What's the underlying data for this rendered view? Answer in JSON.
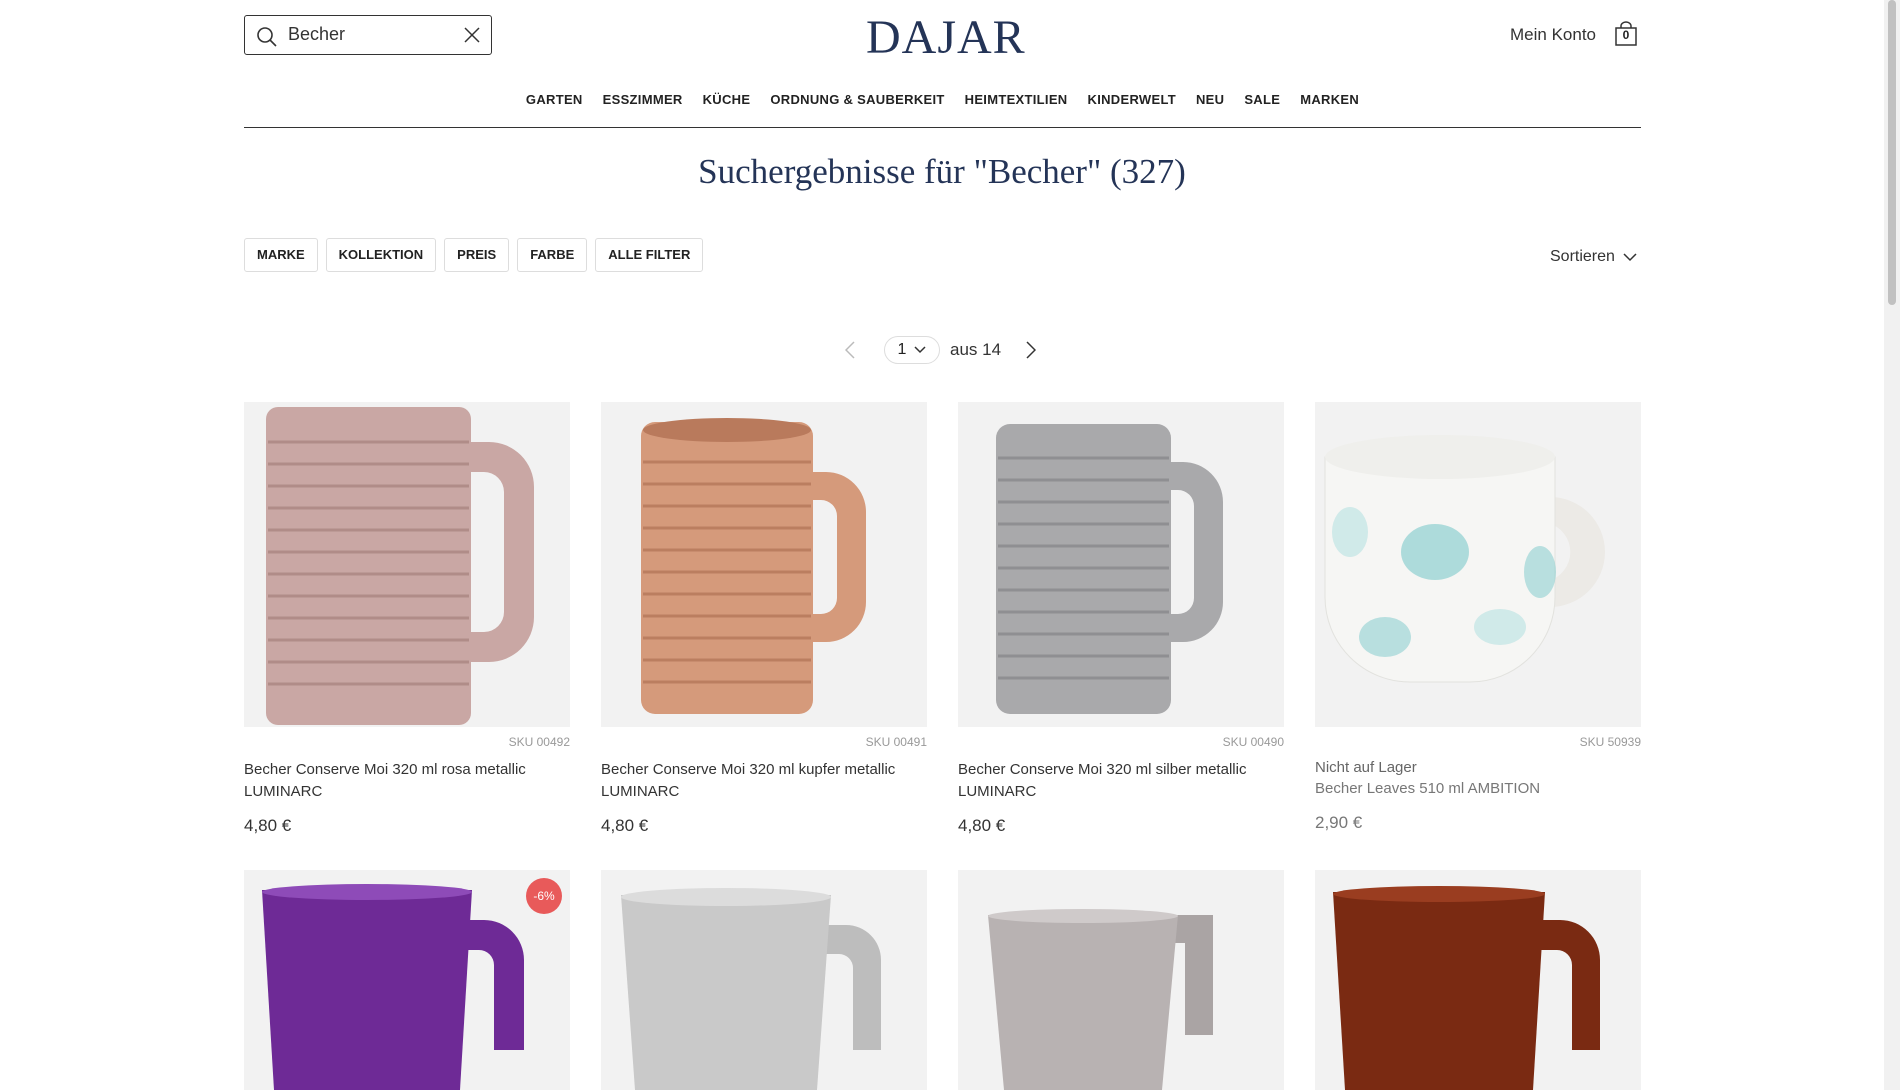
{
  "header": {
    "search_value": "Becher",
    "logo": "DAJAR",
    "account_label": "Mein Konto",
    "cart_count": "0"
  },
  "nav": [
    "GARTEN",
    "ESSZIMMER",
    "KÜCHE",
    "ORDNUNG & SAUBERKEIT",
    "HEIMTEXTILIEN",
    "KINDERWELT",
    "NEU",
    "SALE",
    "MARKEN"
  ],
  "results_title": "Suchergebnisse für \"Becher\" (327)",
  "filters": [
    "MARKE",
    "KOLLEKTION",
    "PREIS",
    "FARBE",
    "ALLE FILTER"
  ],
  "sort_label": "Sortieren",
  "pagination": {
    "current": "1",
    "of_label": "aus 14"
  },
  "products": [
    {
      "sku": "SKU 00492",
      "name": "Becher Conserve Moi 320 ml rosa metallic LUMINARC",
      "price": "4,80 €",
      "stock": "",
      "color": "#c9a7a4",
      "icon": "ribbed-mug-rose"
    },
    {
      "sku": "SKU 00491",
      "name": "Becher Conserve Moi 320 ml kupfer metallic LUMINARC",
      "price": "4,80 €",
      "stock": "",
      "color": "#d59a7b",
      "icon": "ribbed-mug-copper"
    },
    {
      "sku": "SKU 00490",
      "name": "Becher Conserve Moi 320 ml silber metallic LUMINARC",
      "price": "4,80 €",
      "stock": "",
      "color": "#a9a9ab",
      "icon": "ribbed-mug-silver"
    },
    {
      "sku": "SKU 50939",
      "name": "Becher Leaves 510 ml AMBITION",
      "price": "2,90 €",
      "stock": "Nicht auf Lager",
      "color": "#f4f4f2",
      "icon": "leaf-pattern-mug"
    }
  ],
  "products_row2": [
    {
      "badge": "-6%",
      "color": "#6e2a96",
      "icon": "purple-mug"
    },
    {
      "badge": "",
      "color": "#bdbdbd",
      "icon": "silver-mug"
    },
    {
      "badge": "",
      "color": "#b8b2b2",
      "icon": "grey-metallic-mug"
    },
    {
      "badge": "",
      "color": "#7a2a12",
      "icon": "brown-mug"
    }
  ]
}
